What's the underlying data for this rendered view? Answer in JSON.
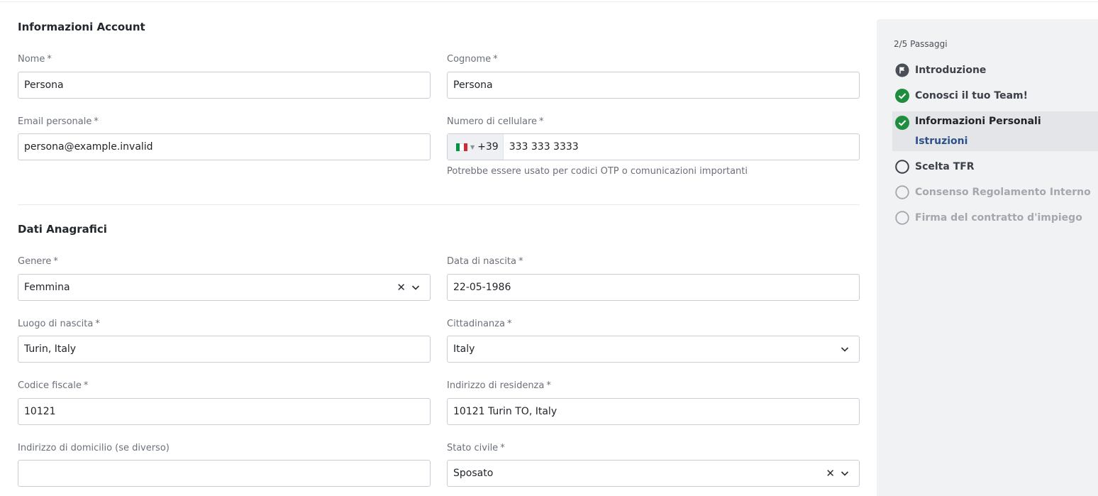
{
  "account": {
    "title": "Informazioni Account",
    "nome": {
      "label": "Nome",
      "required": "*",
      "value": "Persona"
    },
    "cognome": {
      "label": "Cognome",
      "required": "*",
      "value": "Persona"
    },
    "email": {
      "label": "Email personale",
      "required": "*",
      "value": "persona@example.invalid"
    },
    "cellulare": {
      "label": "Numero di cellulare",
      "required": "*",
      "prefix": "+39",
      "value": "333 333 3333",
      "hint": "Potrebbe essere usato per codici OTP o comunicazioni importanti"
    }
  },
  "anagrafici": {
    "title": "Dati Anagrafici",
    "genere": {
      "label": "Genere",
      "required": "*",
      "value": "Femmina"
    },
    "data_nascita": {
      "label": "Data di nascita",
      "required": "*",
      "value": "22-05-1986"
    },
    "luogo_nascita": {
      "label": "Luogo di nascita",
      "required": "*",
      "value": "Turin, Italy"
    },
    "cittadinanza": {
      "label": "Cittadinanza",
      "required": "*",
      "value": "Italy"
    },
    "codice_fiscale": {
      "label": "Codice fiscale",
      "required": "*",
      "value": "10121"
    },
    "residenza": {
      "label": "Indirizzo di residenza",
      "required": "*",
      "value": "10121 Turin TO, Italy"
    },
    "domicilio": {
      "label": "Indirizzo di domicilio (se diverso)",
      "value": ""
    },
    "stato_civile": {
      "label": "Stato civile",
      "required": "*",
      "value": "Sposato"
    }
  },
  "sidebar": {
    "steps_count": "2/5 Passaggi",
    "steps": [
      {
        "label": "Introduzione",
        "state": "flag"
      },
      {
        "label": "Conosci il tuo Team!",
        "state": "done"
      },
      {
        "label": "Informazioni Personali",
        "state": "active",
        "sub": "Istruzioni"
      },
      {
        "label": "Scelta TFR",
        "state": "todo"
      },
      {
        "label": "Consenso Regolamento Interno",
        "state": "disabled"
      },
      {
        "label": "Firma del contratto d'impiego",
        "state": "disabled"
      }
    ]
  },
  "colors": {
    "done_green": "#1e8e3e",
    "flag_dark": "#4a4f57",
    "link_blue": "#2d5089",
    "flag_it": [
      "#009246",
      "#ffffff",
      "#ce2b37"
    ]
  }
}
